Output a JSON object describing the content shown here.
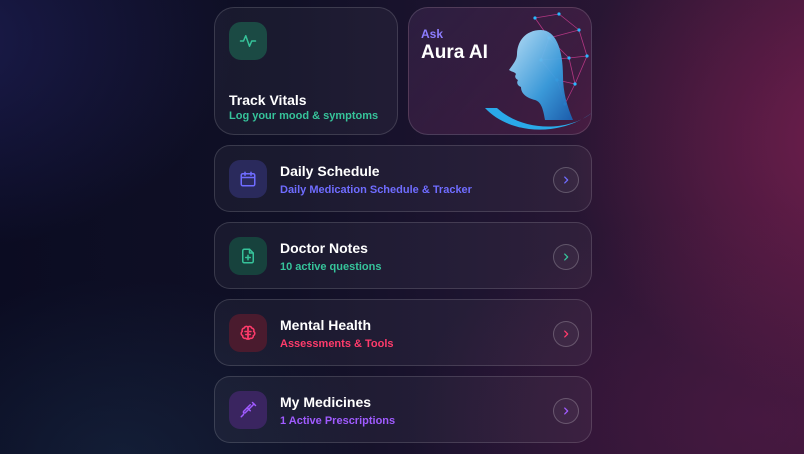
{
  "vitals": {
    "title": "Track Vitals",
    "subtitle": "Log your mood & symptoms",
    "icon": "activity-icon",
    "color": "#36c39a"
  },
  "aura": {
    "ask_label": "Ask",
    "name": "Aura AI",
    "image": "ai-face-network-illustration"
  },
  "rows": [
    {
      "title": "Daily Schedule",
      "subtitle": "Daily Medication Schedule & Tracker",
      "icon": "calendar-icon",
      "color": "#6f6cff"
    },
    {
      "title": "Doctor Notes",
      "subtitle": "10 active questions",
      "icon": "file-plus-icon",
      "color": "#36c39a"
    },
    {
      "title": "Mental Health",
      "subtitle": "Assessments & Tools",
      "icon": "brain-icon",
      "color": "#ff3b6b"
    },
    {
      "title": "My Medicines",
      "subtitle": "1 Active Prescriptions",
      "icon": "syringe-icon",
      "color": "#a05bff"
    }
  ]
}
